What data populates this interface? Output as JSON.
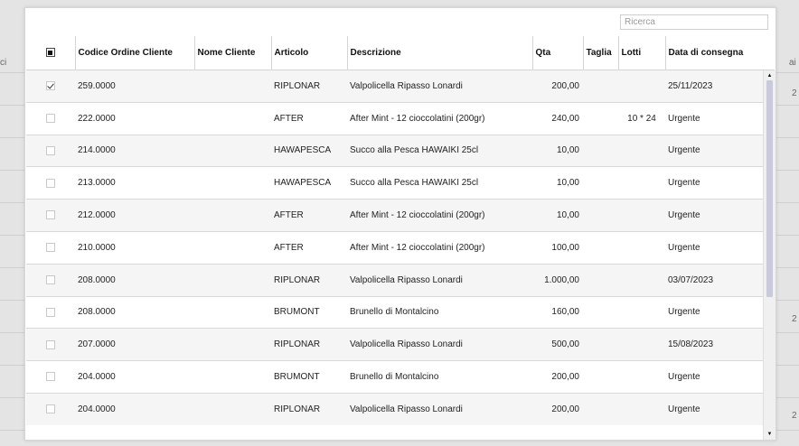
{
  "search": {
    "placeholder": "Ricerca",
    "value": ""
  },
  "table": {
    "columns": [
      "Codice Ordine Cliente",
      "Nome Cliente",
      "Articolo",
      "Descrizione",
      "Qta",
      "Taglia",
      "Lotti",
      "Data di consegna"
    ],
    "rows": [
      {
        "checked": true,
        "codice": "259.0000",
        "nome": "",
        "articolo": "RIPLONAR",
        "descrizione": "Valpolicella Ripasso Lonardi",
        "qta": "200,00",
        "taglia": "",
        "lotti": "",
        "data": "25/11/2023"
      },
      {
        "checked": false,
        "codice": "222.0000",
        "nome": "",
        "articolo": "AFTER",
        "descrizione": "After Mint - 12 cioccolatini (200gr)",
        "qta": "240,00",
        "taglia": "",
        "lotti": "10 * 24",
        "data": "Urgente"
      },
      {
        "checked": false,
        "codice": "214.0000",
        "nome": "",
        "articolo": "HAWAPESCA",
        "descrizione": "Succo alla Pesca HAWAIKI 25cl",
        "qta": "10,00",
        "taglia": "",
        "lotti": "",
        "data": "Urgente"
      },
      {
        "checked": false,
        "codice": "213.0000",
        "nome": "",
        "articolo": "HAWAPESCA",
        "descrizione": "Succo alla Pesca HAWAIKI 25cl",
        "qta": "10,00",
        "taglia": "",
        "lotti": "",
        "data": "Urgente"
      },
      {
        "checked": false,
        "codice": "212.0000",
        "nome": "",
        "articolo": "AFTER",
        "descrizione": "After Mint - 12 cioccolatini (200gr)",
        "qta": "10,00",
        "taglia": "",
        "lotti": "",
        "data": "Urgente"
      },
      {
        "checked": false,
        "codice": "210.0000",
        "nome": "",
        "articolo": "AFTER",
        "descrizione": "After Mint - 12 cioccolatini (200gr)",
        "qta": "100,00",
        "taglia": "",
        "lotti": "",
        "data": "Urgente"
      },
      {
        "checked": false,
        "codice": "208.0000",
        "nome": "",
        "articolo": "RIPLONAR",
        "descrizione": "Valpolicella Ripasso Lonardi",
        "qta": "1.000,00",
        "taglia": "",
        "lotti": "",
        "data": "03/07/2023"
      },
      {
        "checked": false,
        "codice": "208.0000",
        "nome": "",
        "articolo": "BRUMONT",
        "descrizione": "Brunello di Montalcino",
        "qta": "160,00",
        "taglia": "",
        "lotti": "",
        "data": "Urgente"
      },
      {
        "checked": false,
        "codice": "207.0000",
        "nome": "",
        "articolo": "RIPLONAR",
        "descrizione": "Valpolicella Ripasso Lonardi",
        "qta": "500,00",
        "taglia": "",
        "lotti": "",
        "data": "15/08/2023"
      },
      {
        "checked": false,
        "codice": "204.0000",
        "nome": "",
        "articolo": "BRUMONT",
        "descrizione": "Brunello di Montalcino",
        "qta": "200,00",
        "taglia": "",
        "lotti": "",
        "data": "Urgente"
      },
      {
        "checked": false,
        "codice": "204.0000",
        "nome": "",
        "articolo": "RIPLONAR",
        "descrizione": "Valpolicella Ripasso Lonardi",
        "qta": "200,00",
        "taglia": "",
        "lotti": "",
        "data": "Urgente"
      }
    ]
  },
  "background_fragments": [
    "ci",
    "ai",
    "2",
    "2",
    "2"
  ],
  "colors": {
    "row_alt": "#f5f5f5",
    "scroll_thumb": "#c9cbdc",
    "border": "#d4d4d4"
  },
  "icons": {
    "select_all": "select-all-checkbox-icon",
    "scroll_up": "caret-up-icon",
    "scroll_down": "caret-down-icon"
  }
}
